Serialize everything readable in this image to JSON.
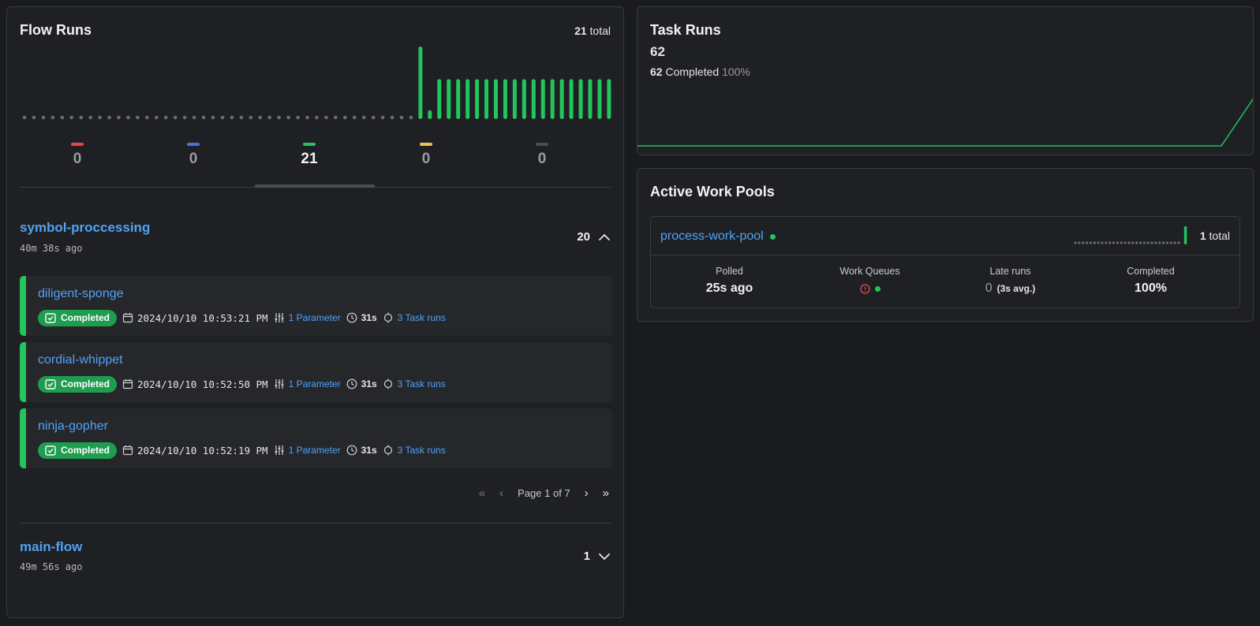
{
  "flow_runs": {
    "title": "Flow Runs",
    "total_count": "21",
    "total_label": "total",
    "states": [
      {
        "count": "0",
        "color": "#ef4444",
        "active": false
      },
      {
        "count": "0",
        "color": "#4f6fd8",
        "active": false
      },
      {
        "count": "21",
        "color": "#22c55e",
        "active": true
      },
      {
        "count": "0",
        "color": "#e8c84a",
        "active": false
      },
      {
        "count": "0",
        "color": "#4b4d55",
        "active": false
      }
    ],
    "histogram": {
      "empty_slots": 42,
      "bar_levels": [
        1.0,
        0.12,
        0.55,
        0.55,
        0.55,
        0.55,
        0.55,
        0.55,
        0.55,
        0.55,
        0.55,
        0.55,
        0.55,
        0.55,
        0.55,
        0.55,
        0.55,
        0.55,
        0.55,
        0.55,
        0.55
      ],
      "bar_color": "#22c55e"
    },
    "groups": [
      {
        "name": "symbol-proccessing",
        "ago": "40m 38s ago",
        "count": "20",
        "expanded": true,
        "runs": [
          {
            "name": "diligent-sponge",
            "state": "Completed",
            "date": "2024/10/10 10:53:21 PM",
            "params": "1 Parameter",
            "duration": "31s",
            "tasks": "3 Task runs"
          },
          {
            "name": "cordial-whippet",
            "state": "Completed",
            "date": "2024/10/10 10:52:50 PM",
            "params": "1 Parameter",
            "duration": "31s",
            "tasks": "3 Task runs"
          },
          {
            "name": "ninja-gopher",
            "state": "Completed",
            "date": "2024/10/10 10:52:19 PM",
            "params": "1 Parameter",
            "duration": "31s",
            "tasks": "3 Task runs"
          }
        ],
        "pager": {
          "label": "Page 1 of 7"
        }
      },
      {
        "name": "main-flow",
        "ago": "49m 56s ago",
        "count": "1",
        "expanded": false
      }
    ]
  },
  "task_runs": {
    "title": "Task Runs",
    "count": "62",
    "completed_count": "62",
    "completed_label": "Completed",
    "completed_pct": "100%",
    "line_color": "#22c55e"
  },
  "work_pools": {
    "title": "Active Work Pools",
    "pool": {
      "name": "process-work-pool",
      "status_color": "#22c55e",
      "total_count": "1",
      "total_label": "total",
      "spark_empty_slots": 28,
      "stats": {
        "polled_label": "Polled",
        "polled_value": "25s ago",
        "queues_label": "Work Queues",
        "late_label": "Late runs",
        "late_value": "0",
        "late_avg": "(3s avg.)",
        "completed_label": "Completed",
        "completed_value": "100%"
      }
    }
  }
}
